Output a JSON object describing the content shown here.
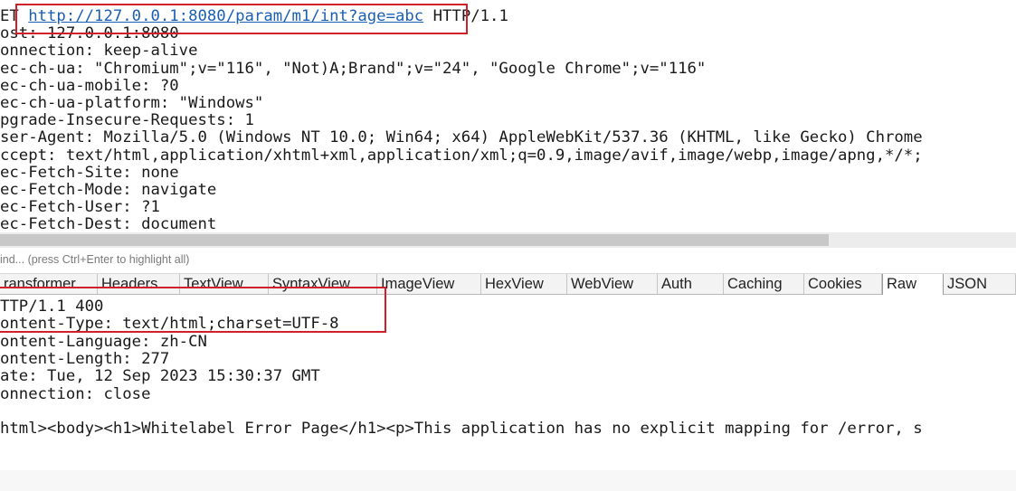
{
  "request": {
    "method_fragment": "ET",
    "url": "http://127.0.0.1:8080/param/m1/int?age=abc",
    "protocol": "HTTP/1.1",
    "headers": [
      "ost: 127.0.0.1:8080",
      "onnection: keep-alive",
      "ec-ch-ua: \"Chromium\";v=\"116\", \"Not)A;Brand\";v=\"24\", \"Google Chrome\";v=\"116\"",
      "ec-ch-ua-mobile: ?0",
      "ec-ch-ua-platform: \"Windows\"",
      "pgrade-Insecure-Requests: 1",
      "ser-Agent: Mozilla/5.0 (Windows NT 10.0; Win64; x64) AppleWebKit/537.36 (KHTML, like Gecko) Chrome",
      "ccept: text/html,application/xhtml+xml,application/xml;q=0.9,image/avif,image/webp,image/apng,*/*;",
      "ec-Fetch-Site: none",
      "ec-Fetch-Mode: navigate",
      "ec-Fetch-User: ?1",
      "ec-Fetch-Dest: document"
    ]
  },
  "find_placeholder": "ind... (press Ctrl+Enter to highlight all)",
  "response_tabs": [
    {
      "label": "ransformer",
      "active": false
    },
    {
      "label": "Headers",
      "active": false
    },
    {
      "label": "TextView",
      "active": false
    },
    {
      "label": "SyntaxView",
      "active": false
    },
    {
      "label": "ImageView",
      "active": false
    },
    {
      "label": "HexView",
      "active": false
    },
    {
      "label": "WebView",
      "active": false
    },
    {
      "label": "Auth",
      "active": false
    },
    {
      "label": "Caching",
      "active": false
    },
    {
      "label": "Cookies",
      "active": false
    },
    {
      "label": "Raw",
      "active": true
    },
    {
      "label": "JSON",
      "active": false
    }
  ],
  "response": {
    "lines": [
      "TTP/1.1 400",
      "ontent-Type: text/html;charset=UTF-8",
      "ontent-Language: zh-CN",
      "ontent-Length: 277",
      "ate: Tue, 12 Sep 2023 15:30:37 GMT",
      "onnection: close",
      "",
      "html><body><h1>Whitelabel Error Page</h1><p>This application has no explicit mapping for /error, s"
    ]
  },
  "colors": {
    "highlight_box": "#d0202a",
    "url_link": "#1a5fb4"
  }
}
